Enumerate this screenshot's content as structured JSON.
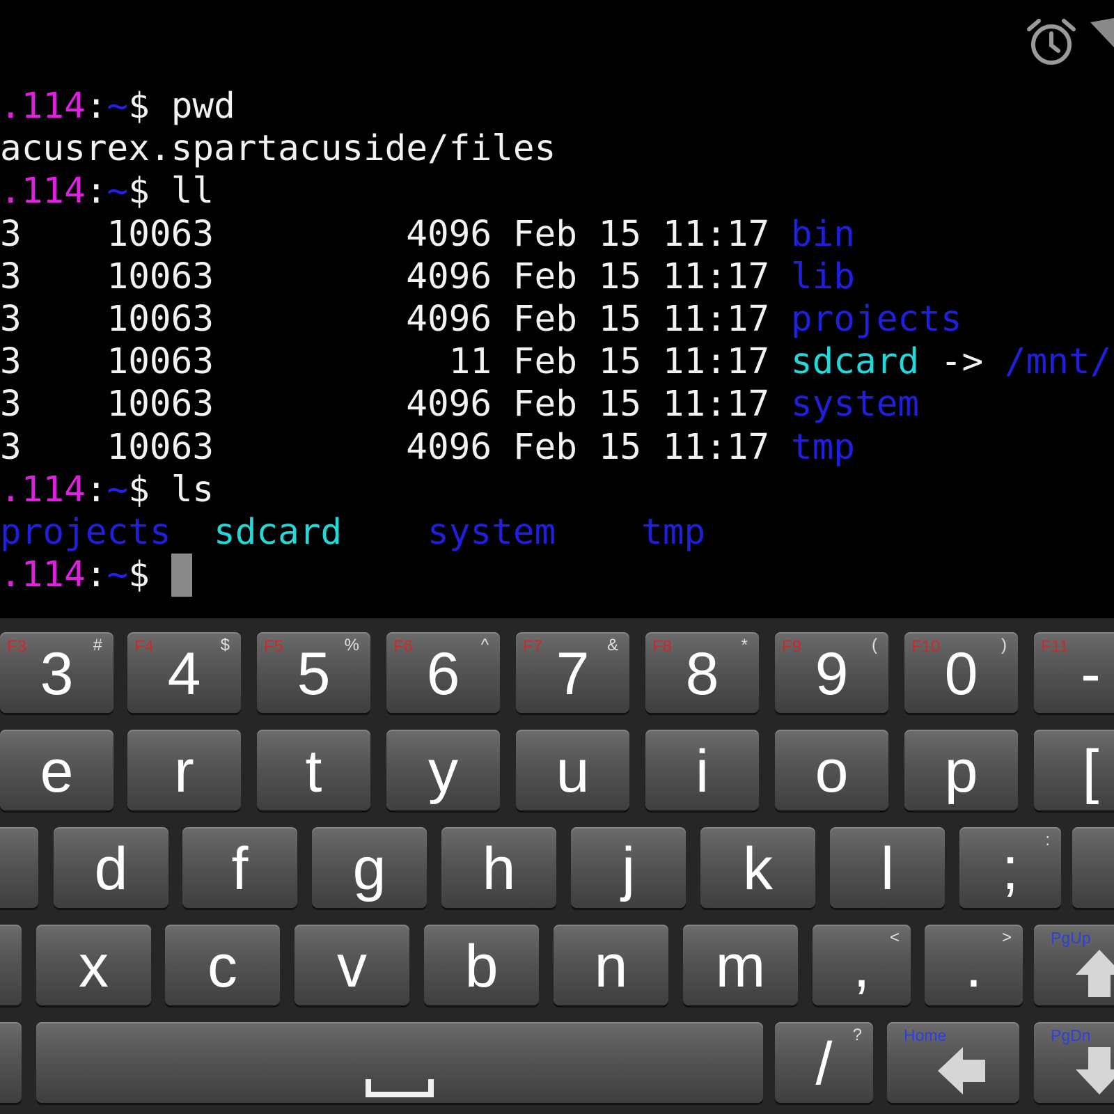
{
  "terminal": {
    "lines": [
      {
        "type": "prompt",
        "host": ".114",
        "sep": ":",
        "path": "~",
        "symbol": "$ ",
        "cmd": "pwd"
      },
      {
        "type": "out",
        "text": "acusrex.spartacuside/files"
      },
      {
        "type": "prompt",
        "host": ".114",
        "sep": ":",
        "path": "~",
        "symbol": "$ ",
        "cmd": "ll"
      },
      {
        "type": "ll",
        "links": "3",
        "owner": "10063",
        "size": "4096",
        "date": "Feb 15 11:17",
        "name": "bin",
        "kind": "dir"
      },
      {
        "type": "ll",
        "links": "3",
        "owner": "10063",
        "size": "4096",
        "date": "Feb 15 11:17",
        "name": "lib",
        "kind": "dir"
      },
      {
        "type": "ll",
        "links": "3",
        "owner": "10063",
        "size": "4096",
        "date": "Feb 15 11:17",
        "name": "projects",
        "kind": "dir"
      },
      {
        "type": "ll",
        "links": "3",
        "owner": "10063",
        "size": "11",
        "date": "Feb 15 11:17",
        "name": "sdcard",
        "kind": "link",
        "arrow": "->",
        "target": "/mnt/"
      },
      {
        "type": "ll",
        "links": "3",
        "owner": "10063",
        "size": "4096",
        "date": "Feb 15 11:17",
        "name": "system",
        "kind": "dir"
      },
      {
        "type": "ll",
        "links": "3",
        "owner": "10063",
        "size": "4096",
        "date": "Feb 15 11:17",
        "name": "tmp",
        "kind": "dir"
      },
      {
        "type": "prompt",
        "host": ".114",
        "sep": ":",
        "path": "~",
        "symbol": "$ ",
        "cmd": "ls"
      },
      {
        "type": "ls",
        "items": [
          {
            "name": "projects",
            "kind": "dir"
          },
          {
            "name": "sdcard",
            "kind": "link"
          },
          {
            "name": "system",
            "kind": "dir"
          },
          {
            "name": "tmp",
            "kind": "dir"
          }
        ]
      },
      {
        "type": "prompt",
        "host": ".114",
        "sep": ":",
        "path": "~",
        "symbol": "$ ",
        "cmd": "",
        "cursor": true
      }
    ],
    "colors": {
      "host": "#e020e0",
      "path": "#2222ee",
      "text": "#f2f2f2",
      "dir": "#1f1fdc",
      "link": "#22d8d8",
      "cursor": "#8a8a8a"
    }
  },
  "status_bar": {
    "icons": [
      "alarm-icon",
      "signal-icon"
    ]
  },
  "keyboard": {
    "rows": [
      [
        {
          "main": "3",
          "alt": "#",
          "fn": "F3"
        },
        {
          "main": "4",
          "alt": "$",
          "fn": "F4"
        },
        {
          "main": "5",
          "alt": "%",
          "fn": "F5"
        },
        {
          "main": "6",
          "alt": "^",
          "fn": "F6"
        },
        {
          "main": "7",
          "alt": "&",
          "fn": "F7"
        },
        {
          "main": "8",
          "alt": "*",
          "fn": "F8"
        },
        {
          "main": "9",
          "alt": "(",
          "fn": "F9"
        },
        {
          "main": "0",
          "alt": ")",
          "fn": "F10"
        },
        {
          "main": "-",
          "alt": "_",
          "fn": "F11"
        }
      ],
      [
        {
          "main": "e"
        },
        {
          "main": "r"
        },
        {
          "main": "t"
        },
        {
          "main": "y"
        },
        {
          "main": "u"
        },
        {
          "main": "i"
        },
        {
          "main": "o"
        },
        {
          "main": "p"
        },
        {
          "main": "[",
          "alt": "{"
        }
      ],
      [
        {
          "main": ""
        },
        {
          "main": "d"
        },
        {
          "main": "f"
        },
        {
          "main": "g"
        },
        {
          "main": "h"
        },
        {
          "main": "j"
        },
        {
          "main": "k"
        },
        {
          "main": "l"
        },
        {
          "main": ";",
          "alt": ":"
        },
        {
          "main": ""
        }
      ],
      [
        {
          "main": ""
        },
        {
          "main": "x"
        },
        {
          "main": "c"
        },
        {
          "main": "v"
        },
        {
          "main": "b"
        },
        {
          "main": "n"
        },
        {
          "main": "m"
        },
        {
          "main": ",",
          "alt": "<"
        },
        {
          "main": ".",
          "alt": ">"
        },
        {
          "main": "",
          "blue": "PgUp",
          "icon": "arrow-up-icon"
        }
      ],
      [
        {
          "main": ""
        },
        {
          "main": "",
          "icon": "space-bar-icon"
        },
        {
          "main": "/",
          "alt": "?"
        },
        {
          "main": "",
          "blue": "Home",
          "icon": "arrow-left-icon"
        },
        {
          "main": "",
          "blue": "PgDn",
          "icon": "arrow-down-icon"
        }
      ]
    ]
  }
}
